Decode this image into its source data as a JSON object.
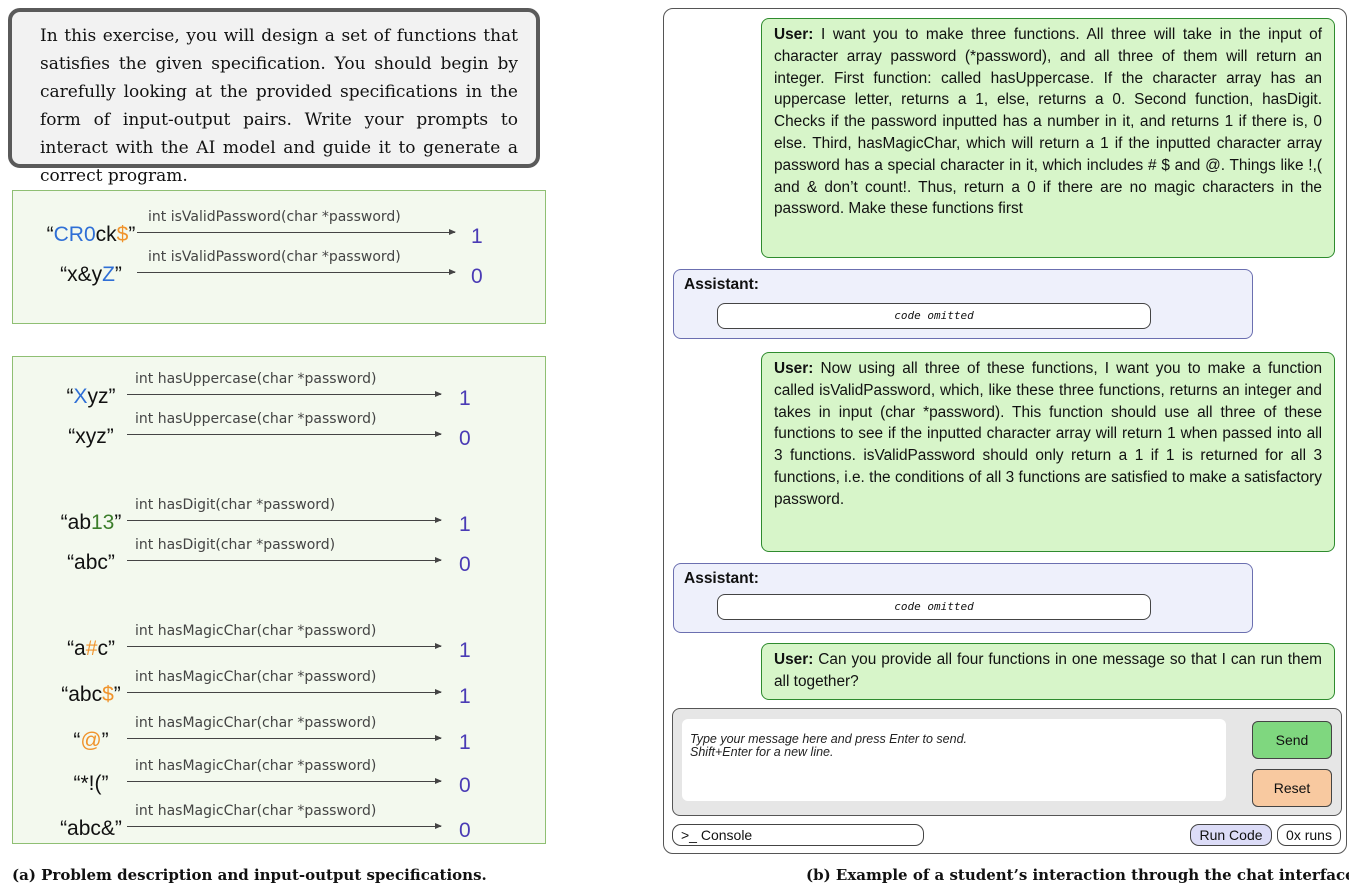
{
  "left": {
    "description": "In this exercise, you will design a set of functions that satisfies the given specification. You should begin by carefully looking at the provided specifications in the form of input-output pairs. Write your prompts to interact with the AI model and guide it to generate a correct program.",
    "spec_top": [
      {
        "input": [
          {
            "t": "“"
          },
          {
            "t": "CR0",
            "c": "blue"
          },
          {
            "t": "ck"
          },
          {
            "t": "$",
            "c": "orange"
          },
          {
            "t": "”"
          }
        ],
        "function": "int isValidPassword(char *password)",
        "output": "1"
      },
      {
        "input": [
          {
            "t": "“x&y"
          },
          {
            "t": "Z",
            "c": "blue"
          },
          {
            "t": "”"
          }
        ],
        "function": "int isValidPassword(char *password)",
        "output": "0"
      }
    ],
    "spec_bottom": [
      {
        "input": [
          {
            "t": "“"
          },
          {
            "t": "X",
            "c": "blue"
          },
          {
            "t": "yz”"
          }
        ],
        "function": "int hasUppercase(char *password)",
        "output": "1"
      },
      {
        "input": [
          {
            "t": "“xyz”"
          }
        ],
        "function": "int hasUppercase(char *password)",
        "output": "0"
      },
      {
        "input": [
          {
            "t": "“ab"
          },
          {
            "t": "13",
            "c": "green"
          },
          {
            "t": "”"
          }
        ],
        "function": "int hasDigit(char *password)",
        "output": "1"
      },
      {
        "input": [
          {
            "t": "“abc”"
          }
        ],
        "function": "int hasDigit(char *password)",
        "output": "0"
      },
      {
        "input": [
          {
            "t": "“a"
          },
          {
            "t": "#",
            "c": "orange"
          },
          {
            "t": "c”"
          }
        ],
        "function": "int hasMagicChar(char *password)",
        "output": "1"
      },
      {
        "input": [
          {
            "t": "“abc"
          },
          {
            "t": "$",
            "c": "orange"
          },
          {
            "t": "”"
          }
        ],
        "function": "int hasMagicChar(char *password)",
        "output": "1"
      },
      {
        "input": [
          {
            "t": "“"
          },
          {
            "t": "@",
            "c": "orange"
          },
          {
            "t": "”"
          }
        ],
        "function": "int hasMagicChar(char *password)",
        "output": "1"
      },
      {
        "input": [
          {
            "t": "“*!(”"
          }
        ],
        "function": "int hasMagicChar(char *password)",
        "output": "0"
      },
      {
        "input": [
          {
            "t": "“abc&”"
          }
        ],
        "function": "int hasMagicChar(char *password)",
        "output": "0"
      }
    ],
    "caption": "(a) Problem description and input-output specifications."
  },
  "chat": {
    "user_label": "User:",
    "assistant_label": "Assistant:",
    "messages": [
      {
        "role": "user",
        "text": "I want you to make three functions. All three will take in the input of character array password (*password), and all three of them will return an integer. First function: called hasUppercase. If the character array has an uppercase letter, returns a 1, else, returns a 0. Second function, hasDigit. Checks if the password inputted has a number in it, and returns 1 if there is, 0 else. Third, hasMagicChar, which will return a 1 if the inputted character array password has a special character in it, which includes # $ and @. Things like !,( and & don’t count!. Thus, return a 0 if there are no magic characters in the password. Make these functions first"
      },
      {
        "role": "assistant",
        "code": "code omitted"
      },
      {
        "role": "user",
        "text": "Now using all three of these functions, I want you to make a function called isValidPassword, which, like these three functions, returns an integer and takes in input (char *password). This function should use all three of these functions to see if the inputted character array will return 1 when passed into all 3 functions. isValidPassword should only return a 1 if 1 is returned for all 3 functions, i.e. the conditions of all 3 functions are satisfied to make a satisfactory password."
      },
      {
        "role": "assistant",
        "code": "code omitted"
      },
      {
        "role": "user",
        "text": "Can you provide all four functions in one message so that I can run them all together?"
      }
    ],
    "input_placeholder_line1": "Type your message here and press Enter to send.",
    "input_placeholder_line2": "Shift+Enter for a new line.",
    "send_label": "Send",
    "reset_label": "Reset",
    "console_label": ">_ Console",
    "run_code_label": "Run Code",
    "runs_label": "0x runs",
    "caption": "(b) Example of a student’s interaction through the chat interface.",
    "colors": {
      "user_bg": "#d7f5c9",
      "assistant_bg": "#eef0fb",
      "send_bg": "#7fd77f",
      "reset_bg": "#f8c9a0",
      "run_bg": "#dcdcf7"
    }
  }
}
